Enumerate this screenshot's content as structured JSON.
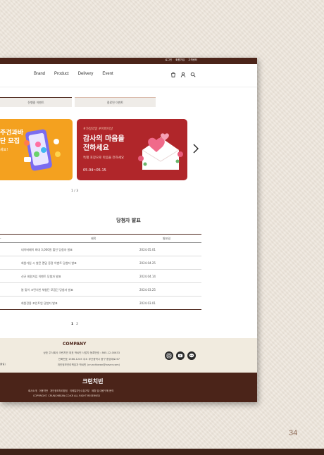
{
  "topbar": {
    "links": [
      "로그인",
      "회원가입",
      "고객센터"
    ]
  },
  "nav": {
    "items": [
      "Brand",
      "Product",
      "Delivery",
      "Event"
    ]
  },
  "tabs": [
    "진행중 이벤트",
    "종료된 이벤트"
  ],
  "banner1": {
    "title_line1": "주견과바",
    "title_line2": "단 모집",
    "sub": "세요!"
  },
  "banner2": {
    "tag": "#가정의달 #어버이날",
    "title_line1": "감사의 마음을",
    "title_line2": "전하세요",
    "desc": "특별 포장으로 마음을 전하세요",
    "date": "05.04~05.15"
  },
  "carousel": {
    "page": "1 / 3"
  },
  "winners": {
    "title": "당첨자 발표",
    "headers": {
      "title": "제목",
      "date": "발표일"
    },
    "rows": [
      {
        "title": "네이버페이 최대 3,000원 할인 당첨자 발표",
        "date": "2024.05.01"
      },
      {
        "title": "회원가입 시 쌀콘 랜덤 증정 이벤트 당첨자 발표",
        "date": "2024.04.25"
      },
      {
        "title": "신규 회원가입 이벤트 당첨자 발표",
        "date": "2024.04.14"
      },
      {
        "title": "봄 맞이 크런치빈 체험단 모집단 당첨자 발표",
        "date": "2024.03.25"
      },
      {
        "title": "회원전용 포인트업 당첨자 발표",
        "date": "2024.03.01"
      }
    ],
    "pages": [
      "1",
      "2"
    ]
  },
  "footer": {
    "company": "COMPANY",
    "line1": "상호 주식회사 크런치빈 대표 박씨빈 사업자 등록번호 : 865-12-00633",
    "line2": "전화번호 1566-1245 주소 부산광역시 중구 중앙대로 67",
    "line3": "개인정보관리책임자 박씨빈 (crunchbean@naver.com)",
    "left_fragment": "출설)",
    "logo": "크런치빈",
    "links": [
      "회사소개",
      "이용약관",
      "개인정보처리방침",
      "이메일무단수집거부",
      "제휴 및 대량구매 문의"
    ],
    "copyright": "COPYRIGHT. CRUNCHBEAN.CO.KR ALL RIGHT RESERVED"
  },
  "page_number": "34",
  "colors": {
    "brand": "#4b2419",
    "banner_orange": "#f4a11f",
    "banner_red": "#b0262a"
  }
}
